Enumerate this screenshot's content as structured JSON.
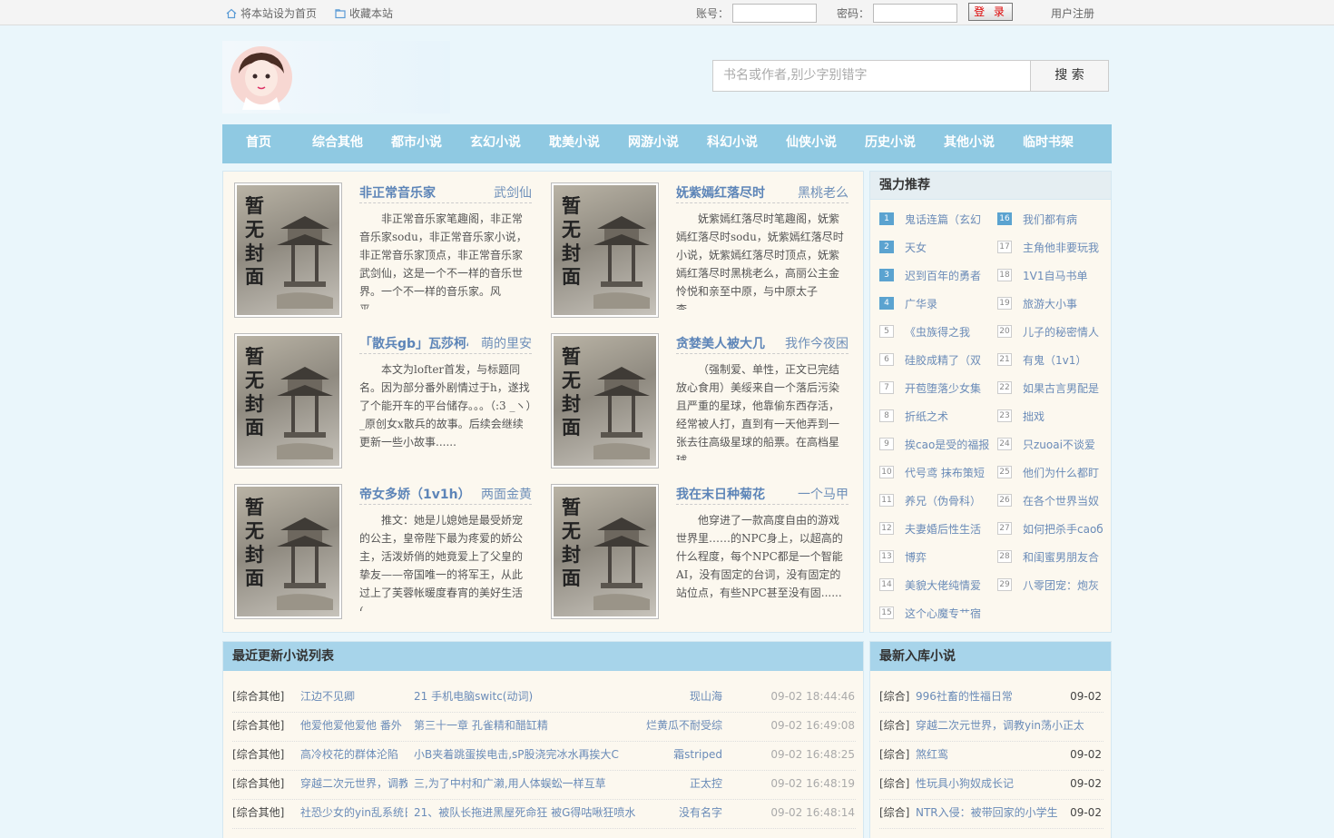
{
  "topbar": {
    "set_home": "将本站设为首页",
    "bookmark": "收藏本站",
    "account_label": "账号：",
    "password_label": "密码：",
    "login_button": "登 录",
    "register": "用户注册"
  },
  "search": {
    "placeholder": "书名或作者,别少字别错字",
    "button": "搜 索"
  },
  "nav": [
    "首页",
    "综合其他",
    "都市小说",
    "玄幻小说",
    "耽美小说",
    "网游小说",
    "科幻小说",
    "仙侠小说",
    "历史小说",
    "其他小说",
    "临时书架"
  ],
  "cover_text": "暂无封面",
  "books": [
    {
      "title": "非正常音乐家",
      "author": "武剑仙",
      "desc": "非正常音乐家笔趣阁，非正常音乐家sodu，非正常音乐家小说，非正常音乐家顶点，非正常音乐家武剑仙，这是一个不一样的音乐世界。一个不一样的音乐家。风平......"
    },
    {
      "title": "妩紫嫣红落尽时",
      "author": "黑桃老么",
      "desc": "妩紫嫣红落尽时笔趣阁，妩紫嫣红落尽时sodu，妩紫嫣红落尽时小说，妩紫嫣红落尽时顶点，妩紫嫣红落尽时黑桃老么，高丽公主金怜悦和亲至中原，与中原太子李......"
    },
    {
      "title": "「散兵gb」瓦莎柯小",
      "author": "萌的里安",
      "desc": "本文为lofter首发，与标题同名。因为部分番外剧情过于h，遂找了个能开车的平台储存。。。（:3 _ヽ）_原创女x散兵的故事。后续会继续更新一些小故事......"
    },
    {
      "title": "贪婪美人被大几",
      "author": "我作今夜困兽",
      "desc": "（强制爱、单性，正文已完结放心食用）美绥来自一个落后污染且严重的星球，他靠偷东西存活，经常被人打，直到有一天他弄到一张去往高级星球的船票。在高档星球......"
    },
    {
      "title": "帝女多娇（1v1h）",
      "author": "两面金黄",
      "desc": "推文：她是儿媳她是最受娇宠的公主，皇帝陛下最为疼爱的娇公主，活泼娇俏的她竟爱上了父皇的挚友——帝国唯一的将军王，从此过上了芙蓉帐暖度春宵的美好生活(......"
    },
    {
      "title": "我在末日种菊花",
      "author": "一个马甲",
      "desc": "他穿进了一款高度自由的游戏世界里……的NPC身上，以超高的什么程度，每个NPC都是一个智能AI，没有固定的台词，没有固定的站位点，有些NPC甚至没有固......"
    }
  ],
  "recommend": {
    "title": "强力推荐",
    "left": [
      "鬼话连篇（玄幻",
      "天女",
      "迟到百年的勇者",
      "广华录",
      "《虫族得之我",
      "硅胶成精了（双",
      "开苞堕落少女集",
      "折纸之术",
      "挨cao是受的福报",
      "代号鸢 抹布策短",
      "养兄（伪骨科）",
      "夫妻婚后性生活",
      "博弈",
      "美貌大佬纯情爱",
      "这个心魔专艹宿"
    ],
    "right": [
      "我们都有病",
      "主角他非要玩我",
      "1V1自马书单",
      "旅游大小事",
      "儿子的秘密情人",
      "有鬼（1v1）",
      "如果古言男配是",
      "拙戏",
      "只zuoai不谈爱",
      "他们为什么都盯",
      "在各个世界当奴",
      "如何把杀手caoб",
      "和闺蜜男朋友合",
      "八零团宠：炮灰"
    ]
  },
  "latest": {
    "title": "最近更新小说列表",
    "rows": [
      {
        "cat": "[综合其他]",
        "book": "江边不见卿",
        "chapter": "21 手机电脑switc(动词)",
        "author": "现山海",
        "time": "09-02 18:44:46"
      },
      {
        "cat": "[综合其他]",
        "book": "他爱他爱他爱他 番外",
        "chapter": "第三十一章 孔雀精和醋缸精",
        "author": "烂黄瓜不耐受综",
        "time": "09-02 16:49:08"
      },
      {
        "cat": "[综合其他]",
        "book": "高冷校花的群体沦陷",
        "chapter": "小B夹着跳蛋挨电击,sP股浇完冰水再挨大C",
        "author": "霜striped",
        "time": "09-02 16:48:25"
      },
      {
        "cat": "[综合其他]",
        "book": "穿越二次元世界，调教",
        "chapter": "三,为了中村和广濑,用人体蜈蚣一样互草",
        "author": "正太控",
        "time": "09-02 16:48:19"
      },
      {
        "cat": "[综合其他]",
        "book": "社恐少女的yin乱系统日",
        "chapter": "21、被队长拖进黑屋死命狂 被G得咕啾狂喷水",
        "author": "没有名字",
        "time": "09-02 16:48:14"
      }
    ]
  },
  "newest": {
    "title": "最新入库小说",
    "rows": [
      {
        "cat": "[综合]",
        "book": "996社畜的性福日常",
        "date": "09-02"
      },
      {
        "cat": "[综合]",
        "book": "穿越二次元世界，调教yin荡小正太",
        "date": ""
      },
      {
        "cat": "[综合]",
        "book": "煞红鸾",
        "date": "09-02"
      },
      {
        "cat": "[综合]",
        "book": "性玩具小狗奴成长记",
        "date": "09-02"
      },
      {
        "cat": "[综合]",
        "book": "NTR入侵：被带回家的小学生",
        "date": "09-02"
      }
    ]
  }
}
